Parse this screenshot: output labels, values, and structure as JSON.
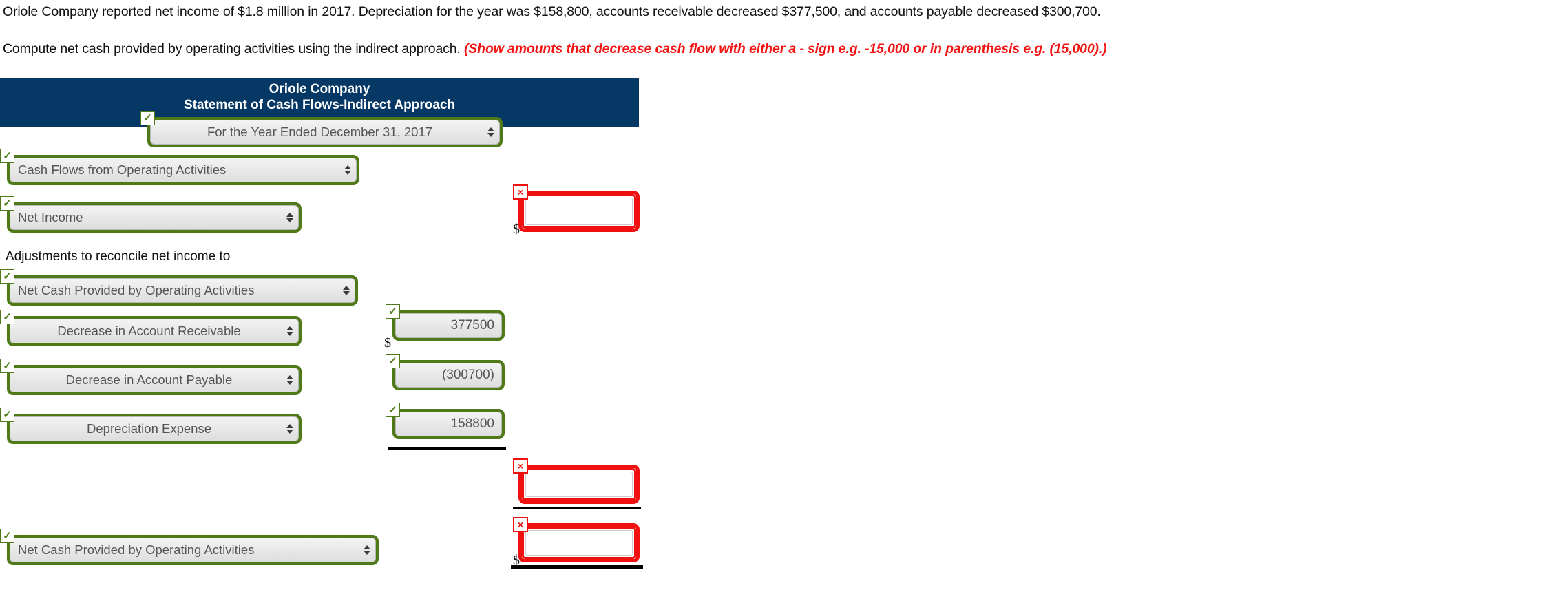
{
  "problem": {
    "line1": "Oriole Company reported net income of $1.8 million in 2017. Depreciation for the year was $158,800, accounts receivable decreased $377,500, and accounts payable decreased $300,700.",
    "line2_main": "Compute net cash provided by operating activities using the indirect approach.",
    "line2_note": "(Show amounts that decrease cash flow with either a - sign e.g. -15,000 or in parenthesis e.g. (15,000).)"
  },
  "statement": {
    "company": "Oriole Company",
    "title": "Statement of Cash Flows-Indirect Approach",
    "period_select": "For the Year Ended December 31, 2017",
    "section_select": "Cash Flows from Operating Activities",
    "net_income_select": "Net Income",
    "net_income_amount": "",
    "adjustments_label": "Adjustments to reconcile net income to",
    "adjustments_target_select": "Net Cash Provided by Operating Activities",
    "adjustment_rows": [
      {
        "account": "Decrease in Account Receivable",
        "amount": "377500"
      },
      {
        "account": "Decrease in Account Payable",
        "amount": "(300700)"
      },
      {
        "account": "Depreciation Expense",
        "amount": "158800"
      }
    ],
    "subtotal_amount": "",
    "total_select": "Net Cash Provided by Operating Activities",
    "total_amount": "",
    "currency_symbol": "$",
    "valid_mark": "✓",
    "invalid_mark": "×"
  },
  "colors": {
    "banner_blue": "#063866",
    "valid_green": "#4f7a17",
    "error_red": "#f01010",
    "note_red": "#f41313"
  }
}
